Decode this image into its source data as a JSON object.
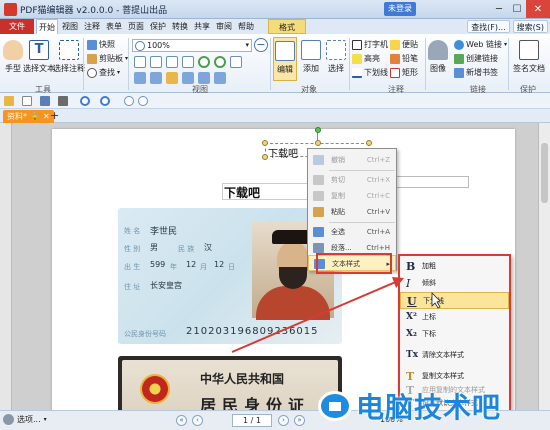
{
  "window": {
    "title": "PDF猫编辑器 v2.0.0.0 - 菩提山出品",
    "user_label": "未登录",
    "controls": [
      "─",
      "☐",
      "✕"
    ]
  },
  "ribbon_tabs": {
    "file": "文件",
    "tabs": [
      "开始",
      "视图",
      "注释",
      "表单",
      "页面",
      "保护",
      "转换",
      "共享",
      "审阅",
      "帮助",
      "格式"
    ],
    "active": "开始",
    "find_label": "查找(F)...",
    "search_label": "搜索(S)"
  },
  "ribbon": {
    "tools": {
      "hand": "手型",
      "select_text": "选择文本",
      "select_annot": "选择注释",
      "group_label": "工具"
    },
    "snapshot": {
      "snapshot": "快照",
      "clipboard": "剪贴板",
      "find": "查找"
    },
    "view": {
      "zoom_value": "100%",
      "group_label": "视图"
    },
    "object": {
      "edit": "编辑",
      "add": "添加",
      "select": "选择",
      "group_label": "对象"
    },
    "annotate": {
      "typewriter": "打字机",
      "note": "便贴",
      "highlight": "高亮",
      "pencil": "铅笔",
      "underline": "下划线",
      "rect": "矩形",
      "group_label": "注释"
    },
    "image": {
      "image": "图像"
    },
    "links": {
      "web_link": "Web 链接",
      "create_link": "创建链接",
      "new_bookmark": "新增书签",
      "group_label": "链接"
    },
    "protect": {
      "sign": "签名文档",
      "group_label": "保护"
    }
  },
  "doc_tab": {
    "name": "资料*"
  },
  "page": {
    "selected_text": "下载吧",
    "heading": "下载吧",
    "idcard": {
      "name_label": "姓 名",
      "name": "李世民",
      "sex_label": "性 别",
      "sex": "男",
      "ethnic_label": "民 族",
      "ethnic": "汉",
      "birth_label": "出 生",
      "birth_year": "599",
      "birth_year_unit": "年",
      "birth_month": "12",
      "birth_month_unit": "月",
      "birth_day": "12",
      "birth_day_unit": "日",
      "address_label": "住 址",
      "address": "长安皇宫",
      "id_label": "公民身份号码",
      "id_number": "210203196809236015"
    },
    "idback": {
      "line1": "中华人民共和国",
      "line2": "居民身份证"
    }
  },
  "context_menu": {
    "items": [
      {
        "label": "撤销",
        "shortcut": "Ctrl+Z",
        "disabled": true
      },
      {
        "label": "剪切",
        "shortcut": "Ctrl+X",
        "disabled": true
      },
      {
        "label": "复制",
        "shortcut": "Ctrl+C",
        "disabled": true
      },
      {
        "label": "粘贴",
        "shortcut": "Ctrl+V",
        "disabled": false
      },
      {
        "label": "全选",
        "shortcut": "Ctrl+A",
        "disabled": false
      },
      {
        "label": "段落...",
        "shortcut": "Ctrl+H",
        "disabled": false
      },
      {
        "label": "文本样式",
        "shortcut": "",
        "disabled": false
      }
    ]
  },
  "submenu": {
    "items": [
      {
        "glyph": "B",
        "label": "加粗"
      },
      {
        "glyph": "I",
        "label": "倾斜"
      },
      {
        "glyph": "U",
        "label": "下划线"
      },
      {
        "glyph": "X²",
        "label": "上标"
      },
      {
        "glyph": "X₂",
        "label": "下标"
      },
      {
        "glyph": "Tx",
        "label": "清除文本样式"
      },
      {
        "glyph": "T",
        "label": "复制文本样式"
      },
      {
        "glyph": "T",
        "label": "应用复制的文本样式"
      },
      {
        "glyph": "T",
        "label": "设置默认文本样式"
      }
    ],
    "highlighted": "下划线"
  },
  "status": {
    "select_label": "选项...",
    "page_indicator": "1 / 1",
    "zoom": "100%"
  },
  "watermark": {
    "text": "电脑技术吧"
  },
  "colors": {
    "file_tab": "#c9302c",
    "doc_tab": "#f7931e",
    "highlight": "#fbe59a",
    "annotation_red": "#d83a34",
    "watermark_blue": "#1c86dd"
  }
}
